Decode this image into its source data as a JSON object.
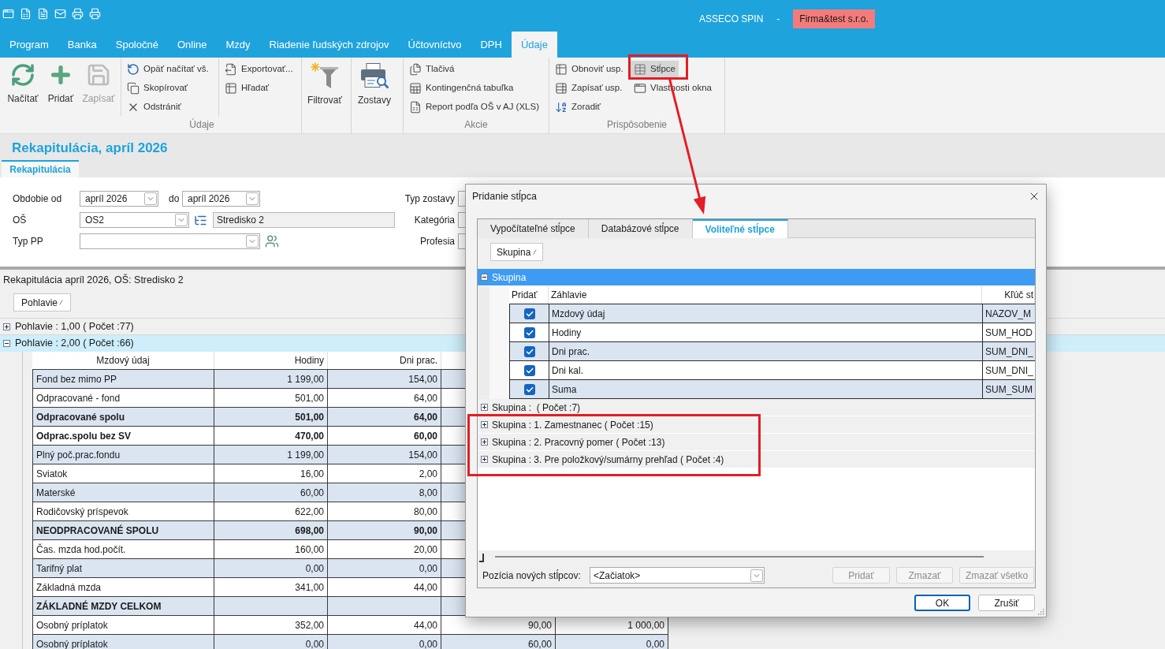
{
  "title_bar": {
    "app_name": "ASSECO SPIN",
    "separator": "-",
    "company": "Firma&test s.r.o."
  },
  "menu_tabs": [
    {
      "label": "Program",
      "selected": false
    },
    {
      "label": "Banka",
      "selected": false
    },
    {
      "label": "Spoločné",
      "selected": false
    },
    {
      "label": "Online",
      "selected": false
    },
    {
      "label": "Mzdy",
      "selected": false
    },
    {
      "label": "Riadenie ľudských zdrojov",
      "selected": false
    },
    {
      "label": "Účtovníctvo",
      "selected": false
    },
    {
      "label": "DPH",
      "selected": false
    },
    {
      "label": "Údaje",
      "selected": true
    }
  ],
  "ribbon": {
    "groups": [
      {
        "label": "Údaje",
        "sections": [
          {
            "kind": "large",
            "items": [
              {
                "label": "Načítať",
                "disabled": false,
                "highlighted": false
              },
              {
                "label": "Pridať",
                "disabled": false,
                "highlighted": false
              },
              {
                "label": "Zapísať",
                "disabled": true,
                "highlighted": false
              }
            ]
          },
          {
            "kind": "small",
            "items": [
              {
                "label": "Opäť načítať vš.",
                "disabled": false,
                "highlighted": false
              },
              {
                "label": "Skopírovať",
                "disabled": false,
                "highlighted": false
              },
              {
                "label": "Odstrániť",
                "disabled": false,
                "highlighted": false
              }
            ]
          },
          {
            "kind": "small",
            "items": [
              {
                "label": "Exportovať...",
                "disabled": false,
                "highlighted": false
              },
              {
                "label": "Hľadať",
                "disabled": false,
                "highlighted": false
              }
            ]
          }
        ]
      },
      {
        "sections": [
          {
            "kind": "large",
            "items": [
              {
                "label": "Filtrovať",
                "disabled": false,
                "highlighted": false
              }
            ]
          }
        ]
      },
      {
        "sections": [
          {
            "kind": "large",
            "items": [
              {
                "label": "Zostavy",
                "disabled": false,
                "highlighted": false
              }
            ]
          }
        ]
      },
      {
        "label": "Akcie",
        "sections": [
          {
            "kind": "small",
            "items": [
              {
                "label": "Tlačivá",
                "disabled": false,
                "highlighted": false
              },
              {
                "label": "Kontingenčná tabuľka",
                "disabled": false,
                "highlighted": false
              },
              {
                "label": "Report podľa OŠ v AJ (XLS)",
                "disabled": false,
                "highlighted": false
              }
            ]
          }
        ]
      },
      {
        "label": "Prispôsobenie",
        "sections": [
          {
            "kind": "small",
            "items": [
              {
                "label": "Obnoviť usp.",
                "disabled": false,
                "highlighted": false
              },
              {
                "label": "Zapísať usp.",
                "disabled": false,
                "highlighted": false
              },
              {
                "label": "Zoradiť",
                "disabled": false,
                "highlighted": false
              },
              {
                "label": "Stĺpce",
                "disabled": false,
                "highlighted": true
              },
              {
                "label": "Vlastnosti okna",
                "disabled": false,
                "highlighted": false
              }
            ]
          }
        ]
      }
    ]
  },
  "page": {
    "title": "Rekapitulácia, apríl 2026",
    "tabs": [
      {
        "label": "Rekapitulácia",
        "selected": true
      }
    ]
  },
  "filters": {
    "period": {
      "label": "Obdobie od",
      "from": "apríl 2026",
      "to_label": "do",
      "to": "apríl 2026"
    },
    "cost_center": {
      "label": "OŠ",
      "code": "OS2",
      "name": "Stredisko 2"
    },
    "employment_type": {
      "label": "Typ PP"
    },
    "report_type": {
      "label": "Typ zostavy"
    },
    "category": {
      "label": "Kategória"
    },
    "profession": {
      "label": "Profesia"
    }
  },
  "report": {
    "caption": "Rekapitulácia apríl 2026, OŠ: Stredisko 2",
    "group_by": [
      {
        "label": "Pohlavie"
      }
    ],
    "groups": [
      {
        "label": "Pohlavie : 1,00 ( Počet :77)",
        "expanded": false,
        "selected": false
      },
      {
        "label": "Pohlavie : 2,00 ( Počet :66)",
        "expanded": true,
        "selected": true,
        "columns": [
          "Mzdový údaj",
          "Hodiny",
          "Dni prac."
        ],
        "rows": [
          {
            "kind": "item",
            "cells": [
              "Fond bez mimo PP",
              "1 199,00",
              "154,00"
            ]
          },
          {
            "kind": "item",
            "cells": [
              "Odpracované - fond",
              "501,00",
              "64,00"
            ]
          },
          {
            "kind": "total",
            "cells": [
              "Odpracované spolu",
              "501,00",
              "64,00"
            ]
          },
          {
            "kind": "total",
            "cells": [
              "Odprac.spolu bez SV",
              "470,00",
              "60,00"
            ]
          },
          {
            "kind": "item",
            "cells": [
              "Plný poč.prac.fondu",
              "1 199,00",
              "154,00"
            ]
          },
          {
            "kind": "item",
            "cells": [
              "Sviatok",
              "16,00",
              "2,00"
            ]
          },
          {
            "kind": "item",
            "cells": [
              "Materské",
              "60,00",
              "8,00"
            ]
          },
          {
            "kind": "item",
            "cells": [
              "Rodičovský príspevok",
              "622,00",
              "80,00"
            ]
          },
          {
            "kind": "total",
            "cells": [
              "NEODPRACOVANÉ SPOLU",
              "698,00",
              "90,00"
            ]
          },
          {
            "kind": "item",
            "cells": [
              "Čas. mzda hod.počít.",
              "160,00",
              "20,00"
            ]
          },
          {
            "kind": "item",
            "cells": [
              "Tarifný plat",
              "0,00",
              "0,00"
            ]
          },
          {
            "kind": "item",
            "cells": [
              "Základná mzda",
              "341,00",
              "44,00"
            ]
          },
          {
            "kind": "total",
            "cells": [
              "ZÁKLADNÉ MZDY CELKOM"
            ]
          },
          {
            "kind": "item",
            "cells": [
              "Osobný príplatok",
              "352,00",
              "44,00",
              "90,00",
              "1 000,00"
            ]
          },
          {
            "kind": "item",
            "cells": [
              "Osobný príplatok",
              "0,00",
              "0,00",
              "60,00",
              "0,00"
            ]
          }
        ]
      }
    ]
  },
  "dialog": {
    "title": "Pridanie stĺpca",
    "tabs": [
      {
        "label": "Vypočítateľné stĺpce",
        "selected": false
      },
      {
        "label": "Databázové stĺpce",
        "selected": false
      },
      {
        "label": "Voliteľné stĺpce",
        "selected": true
      }
    ],
    "group_by": [
      {
        "label": "Skupina"
      }
    ],
    "groups": [
      {
        "label": "Skupina",
        "expanded": true,
        "selected": true,
        "columns": [
          "Pridať",
          "Záhlavie",
          "Kľúč st"
        ],
        "rows": [
          {
            "add": true,
            "heading": "Mzdový údaj",
            "key": "NAZOV_M"
          },
          {
            "add": true,
            "heading": "Hodiny",
            "key": "SUM_HOD"
          },
          {
            "add": true,
            "heading": "Dni prac.",
            "key": "SUM_DNI_"
          },
          {
            "add": true,
            "heading": "Dni kal.",
            "key": "SUM_DNI_"
          },
          {
            "add": true,
            "heading": "Suma",
            "key": "SUM_SUM"
          }
        ]
      },
      {
        "label": "Skupina :  ( Počet :7)",
        "expanded": false,
        "selected": false
      },
      {
        "label": "Skupina : 1. Zamestnanec ( Počet :15)",
        "expanded": false,
        "selected": false
      },
      {
        "label": "Skupina : 2. Pracovný pomer ( Počet :13)",
        "expanded": false,
        "selected": false
      },
      {
        "label": "Skupina : 3. Pre položkový/sumárny prehľad ( Počet :4)",
        "expanded": false,
        "selected": false
      }
    ],
    "position": {
      "label": "Pozícia nových stĺpcov:",
      "value": "<Začiatok>"
    },
    "actions": [
      {
        "label": "Pridať",
        "disabled": true
      },
      {
        "label": "Zmazať",
        "disabled": true
      },
      {
        "label": "Zmazať všetko",
        "disabled": true
      }
    ],
    "buttons": [
      {
        "label": "OK",
        "default": true
      },
      {
        "label": "Zrušiť",
        "default": false
      }
    ]
  }
}
